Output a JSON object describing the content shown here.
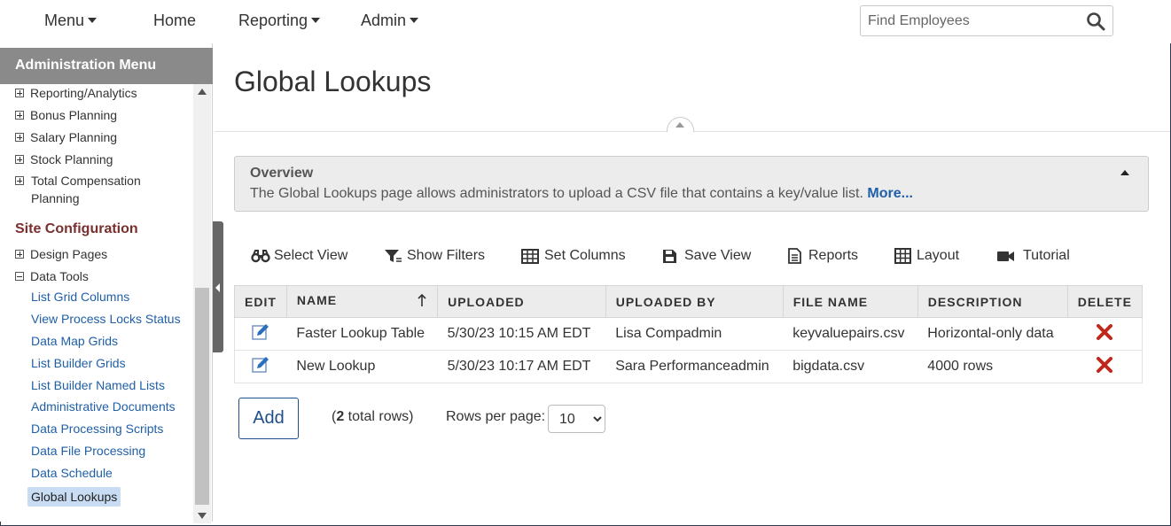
{
  "nav": {
    "menu": "Menu",
    "home": "Home",
    "reporting": "Reporting",
    "admin": "Admin",
    "search_placeholder": "Find Employees"
  },
  "sidebar": {
    "header": "Administration Menu",
    "top_items": [
      {
        "label": "Reporting/Analytics"
      },
      {
        "label": "Bonus Planning"
      },
      {
        "label": "Salary Planning"
      },
      {
        "label": "Stock Planning"
      },
      {
        "label": "Total Compensation Planning"
      }
    ],
    "section_title": "Site Configuration",
    "config_items": [
      {
        "label": "Design Pages",
        "expanded": false
      },
      {
        "label": "Data Tools",
        "expanded": true
      }
    ],
    "data_tools": [
      "List Grid Columns",
      "View Process Locks Status",
      "Data Map Grids",
      "List Builder Grids",
      "List Builder Named Lists",
      "Administrative Documents",
      "Data Processing Scripts",
      "Data File Processing",
      "Data Schedule",
      "Global Lookups"
    ]
  },
  "page": {
    "title": "Global Lookups"
  },
  "overview": {
    "title": "Overview",
    "text": "The Global Lookups page allows administrators to upload a CSV file that contains a key/value list.",
    "more": "More..."
  },
  "toolbar": {
    "select_view": "Select View",
    "show_filters": "Show Filters",
    "set_columns": "Set Columns",
    "save_view": "Save View",
    "reports": "Reports",
    "layout": "Layout",
    "tutorial": "Tutorial"
  },
  "table": {
    "headers": [
      "EDIT",
      "NAME",
      "UPLOADED",
      "UPLOADED BY",
      "FILE NAME",
      "DESCRIPTION",
      "DELETE"
    ],
    "rows": [
      {
        "name": "Faster Lookup Table",
        "uploaded": "5/30/23 10:15 AM EDT",
        "uploaded_by": "Lisa Compadmin",
        "file_name": "keyvaluepairs.csv",
        "description": "Horizontal-only data"
      },
      {
        "name": "New Lookup",
        "uploaded": "5/30/23 10:17 AM EDT",
        "uploaded_by": "Sara Performanceadmin",
        "file_name": "bigdata.csv",
        "description": "4000 rows"
      }
    ]
  },
  "footer": {
    "add_label": "Add",
    "total_rows_open": "(",
    "total_rows_count": "2",
    "total_rows_text": " total rows)",
    "rows_per_page_label": "Rows per page:",
    "rows_per_page_value": "10"
  },
  "colors": {
    "accent": "#1f5fa8",
    "header_bar": "#8a8a8a",
    "section_title": "#7a2e2e",
    "delete_red": "#c0281c",
    "edit_blue": "#2a6fbd"
  }
}
